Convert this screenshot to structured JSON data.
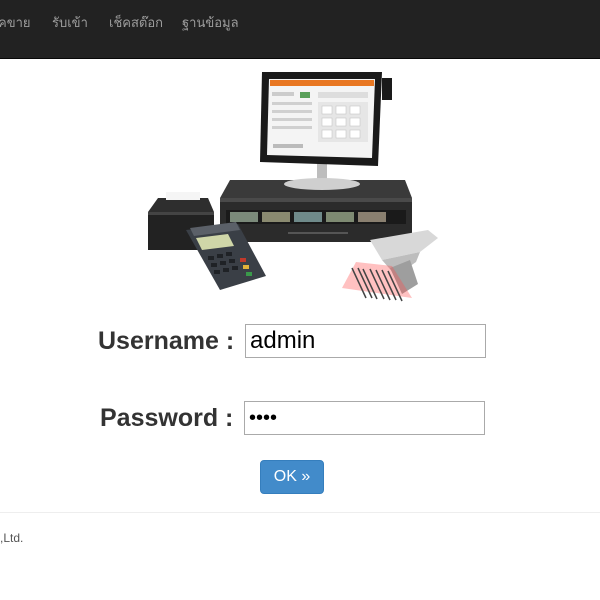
{
  "nav": {
    "items": [
      {
        "label": "คขาย"
      },
      {
        "label": "รับเข้า"
      },
      {
        "label": "เช็คสต๊อก"
      },
      {
        "label": "ฐานข้อมูล"
      }
    ]
  },
  "login": {
    "username_label": "Username :",
    "username_value": "admin",
    "password_label": "Password :",
    "password_value": "1234",
    "ok_label": "OK »"
  },
  "footer": {
    "text": ",Ltd."
  },
  "colors": {
    "navbar_bg": "#222222",
    "nav_text": "#9d9d9d",
    "primary_button": "#428bca"
  },
  "icons": [
    "pos-terminal-illustration",
    "receipt-printer-icon",
    "card-reader-icon",
    "barcode-scanner-icon",
    "cash-drawer-icon"
  ]
}
